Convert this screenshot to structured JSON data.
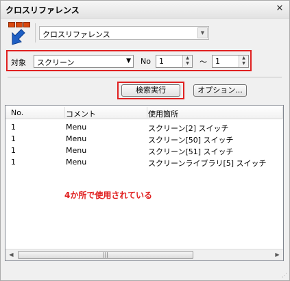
{
  "window": {
    "title": "クロスリファレンス",
    "close_glyph": "✕"
  },
  "function_select": {
    "value": "クロスリファレンス"
  },
  "target": {
    "label": "対象",
    "value": "スクリーン",
    "no_label": "No",
    "from_value": "1",
    "tilde": "～",
    "to_value": "1"
  },
  "buttons": {
    "search": "検索実行",
    "options": "オプション..."
  },
  "list": {
    "columns": [
      "No.",
      "コメント",
      "使用箇所"
    ],
    "rows": [
      [
        "1",
        "Menu",
        "スクリーン[2] スイッチ"
      ],
      [
        "1",
        "Menu",
        "スクリーン[50] スイッチ"
      ],
      [
        "1",
        "Menu",
        "スクリーン[51] スイッチ"
      ],
      [
        "1",
        "Menu",
        "スクリーンライブラリ[5] スイッチ"
      ]
    ],
    "annotation": "4か所で使用されている",
    "scroll_thumb_glyph": "|||"
  },
  "colors": {
    "highlight": "#e02020",
    "icon_orange": "#d9480f",
    "cursor_blue": "#1e5fc4"
  }
}
